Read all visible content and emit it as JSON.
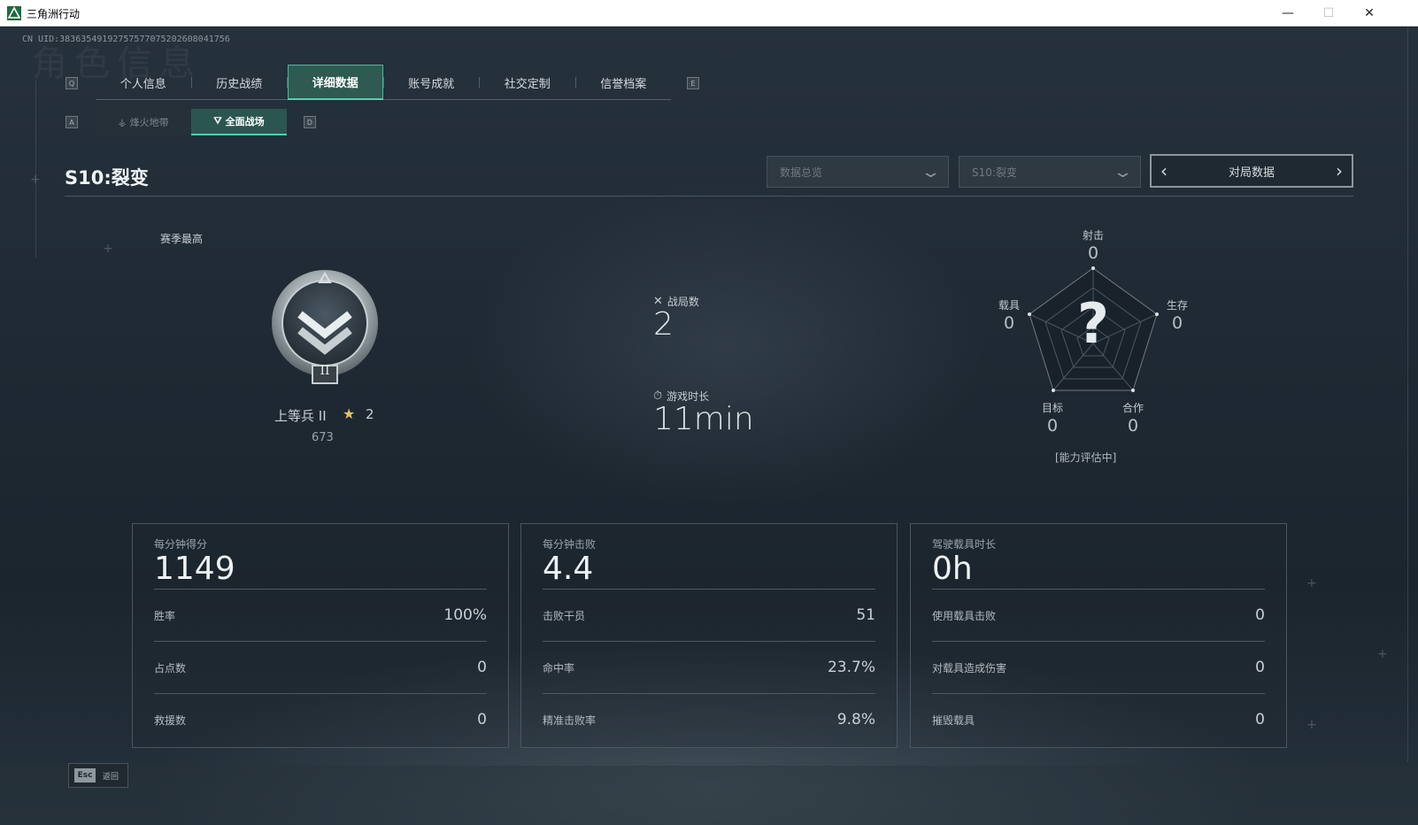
{
  "window": {
    "title": "三角洲行动",
    "minimize": "—",
    "maximize": "☐",
    "close": "✕"
  },
  "header": {
    "uid_line": "CN UID:383635491927575770752026080417​56",
    "ghost_text": "角色信息"
  },
  "tabs": [
    {
      "label": "个人信息",
      "active": false
    },
    {
      "label": "历史战绩",
      "active": false
    },
    {
      "label": "详细数据",
      "active": true
    },
    {
      "label": "账号成就",
      "active": false
    },
    {
      "label": "社交定制",
      "active": false
    },
    {
      "label": "信誉档案",
      "active": false
    }
  ],
  "tab_keys": {
    "left": "Q",
    "right": "E"
  },
  "subtabs": [
    {
      "label": "烽火地带",
      "icon": "arena-icon",
      "active": false
    },
    {
      "label": "全面战场",
      "icon": "battlefield-icon",
      "active": true
    }
  ],
  "subtab_keys": {
    "left": "A",
    "right": "D"
  },
  "season": {
    "title": "S10:裂变"
  },
  "filters": {
    "data_dropdown": "数据总览",
    "season_dropdown": "S10:裂变",
    "pager_label": "对局数据"
  },
  "rank": {
    "caption": "赛季最高",
    "name": "上等兵 II",
    "stars": "2",
    "points": "673",
    "tier_numeral": "II"
  },
  "stats": {
    "matches_label": "战局数",
    "matches_value": "2",
    "playtime_label": "游戏时长",
    "playtime_value": "11min"
  },
  "radar": {
    "center_symbol": "?",
    "status": "[能力评估中]",
    "axes": [
      {
        "label": "射击",
        "value": "0"
      },
      {
        "label": "生存",
        "value": "0"
      },
      {
        "label": "合作",
        "value": "0"
      },
      {
        "label": "目标",
        "value": "0"
      },
      {
        "label": "载具",
        "value": "0"
      }
    ]
  },
  "cards": [
    {
      "title": "每分钟得分",
      "value": "1149",
      "rows": [
        {
          "label": "胜率",
          "value": "100%"
        },
        {
          "label": "占点数",
          "value": "0"
        },
        {
          "label": "救援数",
          "value": "0"
        }
      ]
    },
    {
      "title": "每分钟击败",
      "value": "4.4",
      "rows": [
        {
          "label": "击败干员",
          "value": "51"
        },
        {
          "label": "命中率",
          "value": "23.7%"
        },
        {
          "label": "精准击败率",
          "value": "9.8%"
        }
      ]
    },
    {
      "title": "驾驶载具时长",
      "value": "0h",
      "rows": [
        {
          "label": "使用载具击败",
          "value": "0"
        },
        {
          "label": "对载具造成伤害",
          "value": "0"
        },
        {
          "label": "摧毁载具",
          "value": "0"
        }
      ]
    }
  ],
  "footer": {
    "esc_key": "Esc",
    "esc_label": "返回"
  },
  "colors": {
    "accent": "#46d6ad",
    "tab_active_bg": "#2e5a52",
    "star": "#e3c06a"
  }
}
